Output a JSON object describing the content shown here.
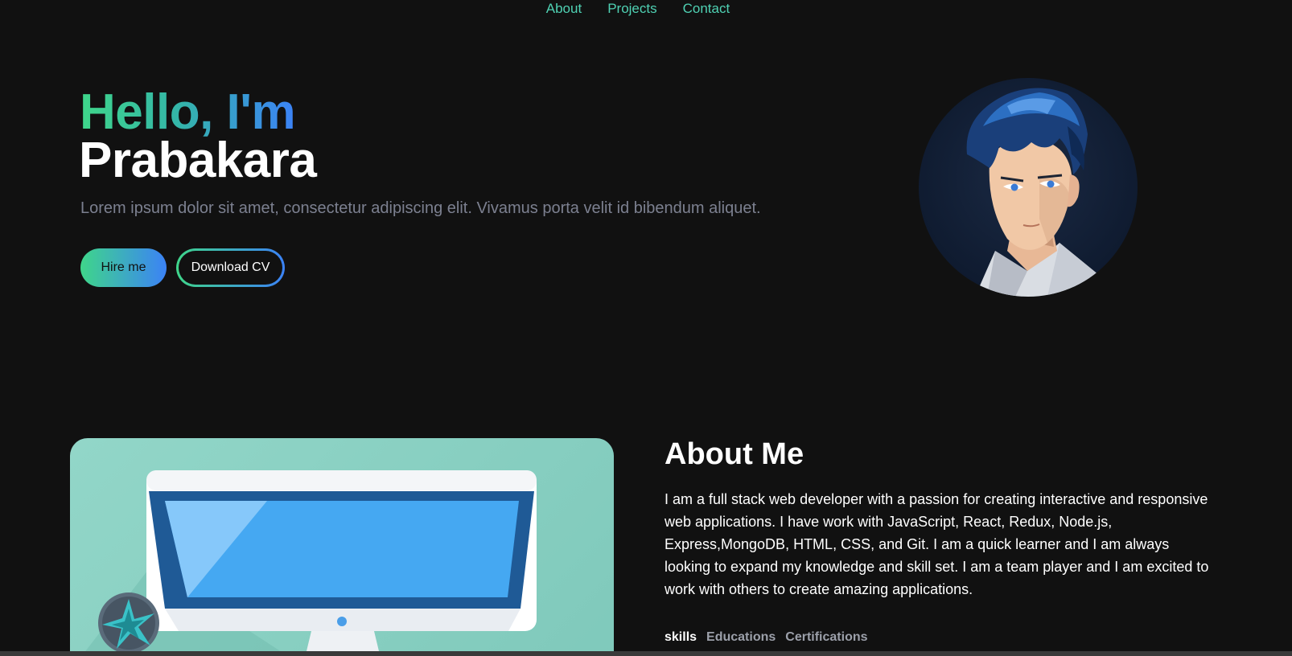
{
  "nav": {
    "items": [
      {
        "label": "About"
      },
      {
        "label": "Projects"
      },
      {
        "label": "Contact"
      }
    ]
  },
  "hero": {
    "greeting": "Hello, I'm",
    "name": "Prabakara",
    "subtitle": "Lorem ipsum dolor sit amet, consectetur adipiscing elit. Vivamus porta velit id bibendum aliquet.",
    "hire_label": "Hire me",
    "cv_label": "Download CV"
  },
  "about": {
    "title": "About Me",
    "text": "I am a full stack web developer with a passion for creating interactive and responsive web applications. I have work with JavaScript, React, Redux, Node.js, Express,MongoDB, HTML, CSS, and Git. I am a quick learner and I am always looking to expand my knowledge and skill set. I am a team player and I am excited to work with others to create amazing applications.",
    "tabs": [
      {
        "label": "skills",
        "active": true
      },
      {
        "label": "Educations",
        "active": false
      },
      {
        "label": "Certifications",
        "active": false
      }
    ]
  },
  "colors": {
    "accent_green": "#3fd68a",
    "accent_blue": "#3b82f6",
    "nav_link": "#4fd1b3",
    "background": "#111111"
  }
}
